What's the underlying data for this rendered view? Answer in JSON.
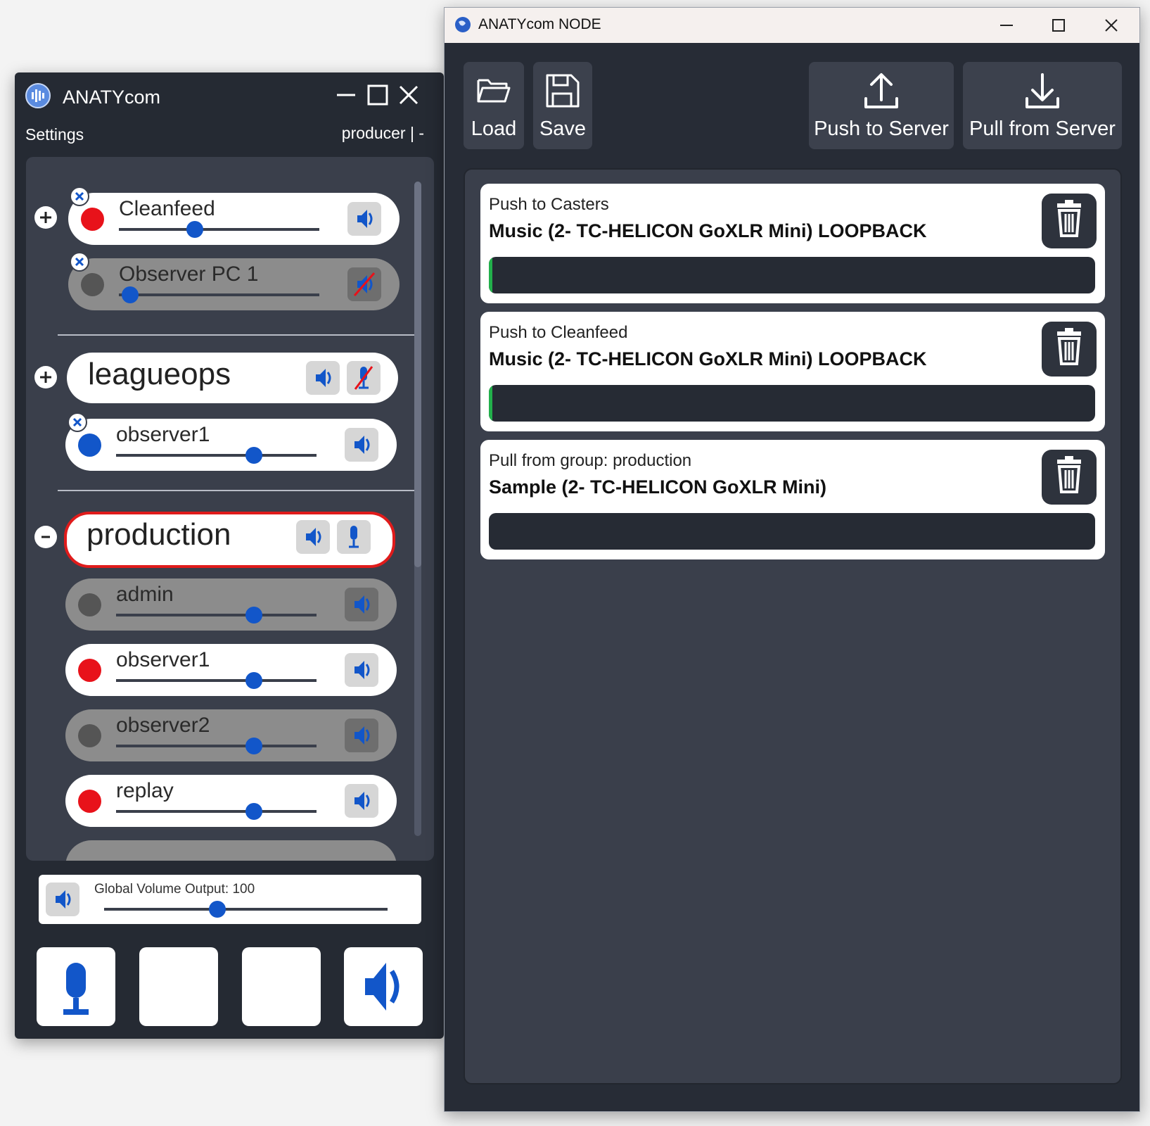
{
  "left_window": {
    "title": "ANATYcom",
    "menu": "Settings",
    "user": "producer | -",
    "groups": [
      {
        "name": "Cleanfeed",
        "expand_symbol": "+",
        "streams": [
          {
            "name": "Cleanfeed",
            "status": "red",
            "active": true,
            "volume": 0.37,
            "muted": false
          },
          {
            "name": "Observer PC 1",
            "status": "gray",
            "active": false,
            "volume": 0.04,
            "muted": true
          }
        ]
      },
      {
        "name": "leagueops",
        "expand_symbol": "+",
        "mic_muted": true,
        "streams": [
          {
            "name": "observer1",
            "status": "blue",
            "active": true,
            "volume": 0.68,
            "muted": false
          }
        ]
      },
      {
        "name": "production",
        "expand_symbol": "-",
        "selected": true,
        "mic_muted": false,
        "streams": [
          {
            "name": "admin",
            "status": "gray",
            "active": false,
            "volume": 0.68,
            "muted": false
          },
          {
            "name": "observer1",
            "status": "red",
            "active": true,
            "volume": 0.68,
            "muted": false
          },
          {
            "name": "observer2",
            "status": "gray",
            "active": false,
            "volume": 0.68,
            "muted": false
          },
          {
            "name": "replay",
            "status": "red",
            "active": true,
            "volume": 0.68,
            "muted": false
          }
        ]
      }
    ],
    "global_volume_label": "Global Volume Output: 100",
    "global_volume_level": 0.4,
    "bottom_buttons": [
      "mic-icon",
      "blank",
      "blank",
      "speaker-icon"
    ]
  },
  "right_window": {
    "title": "ANATYcom NODE",
    "toolbar": {
      "load": "Load",
      "save": "Save",
      "push": "Push to Server",
      "pull": "Pull from Server"
    },
    "routes": [
      {
        "sub": "Push to Casters",
        "main": "Music (2- TC-HELICON GoXLR Mini) LOOPBACK",
        "level": 0.006
      },
      {
        "sub": "Push to Cleanfeed",
        "main": "Music (2- TC-HELICON GoXLR Mini) LOOPBACK",
        "level": 0.006
      },
      {
        "sub": "Pull from group: production",
        "main": "Sample (2- TC-HELICON GoXLR Mini)",
        "level": 0.0
      }
    ]
  },
  "colors": {
    "accent_blue": "#1256c9",
    "status_red": "#e8121a",
    "status_gray": "#555555",
    "selected_border": "#e01b1b",
    "meter_green": "#22b04b"
  }
}
